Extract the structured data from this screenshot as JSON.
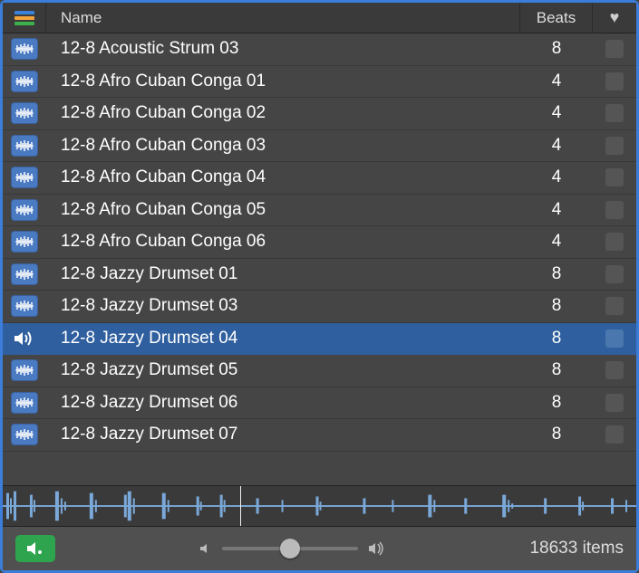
{
  "header": {
    "name_label": "Name",
    "beats_label": "Beats"
  },
  "rows": [
    {
      "name": "12-8 Acoustic Strum 03",
      "beats": "8",
      "selected": false,
      "playing": false
    },
    {
      "name": "12-8 Afro Cuban Conga 01",
      "beats": "4",
      "selected": false,
      "playing": false
    },
    {
      "name": "12-8 Afro Cuban Conga 02",
      "beats": "4",
      "selected": false,
      "playing": false
    },
    {
      "name": "12-8 Afro Cuban Conga 03",
      "beats": "4",
      "selected": false,
      "playing": false
    },
    {
      "name": "12-8 Afro Cuban Conga 04",
      "beats": "4",
      "selected": false,
      "playing": false
    },
    {
      "name": "12-8 Afro Cuban Conga 05",
      "beats": "4",
      "selected": false,
      "playing": false
    },
    {
      "name": "12-8 Afro Cuban Conga 06",
      "beats": "4",
      "selected": false,
      "playing": false
    },
    {
      "name": "12-8 Jazzy Drumset 01",
      "beats": "8",
      "selected": false,
      "playing": false
    },
    {
      "name": "12-8 Jazzy Drumset 03",
      "beats": "8",
      "selected": false,
      "playing": false
    },
    {
      "name": "12-8 Jazzy Drumset 04",
      "beats": "8",
      "selected": true,
      "playing": true
    },
    {
      "name": "12-8 Jazzy Drumset 05",
      "beats": "8",
      "selected": false,
      "playing": false
    },
    {
      "name": "12-8 Jazzy Drumset 06",
      "beats": "8",
      "selected": false,
      "playing": false
    },
    {
      "name": "12-8 Jazzy Drumset 07",
      "beats": "8",
      "selected": false,
      "playing": false
    }
  ],
  "footer": {
    "item_count": "18633 items"
  }
}
